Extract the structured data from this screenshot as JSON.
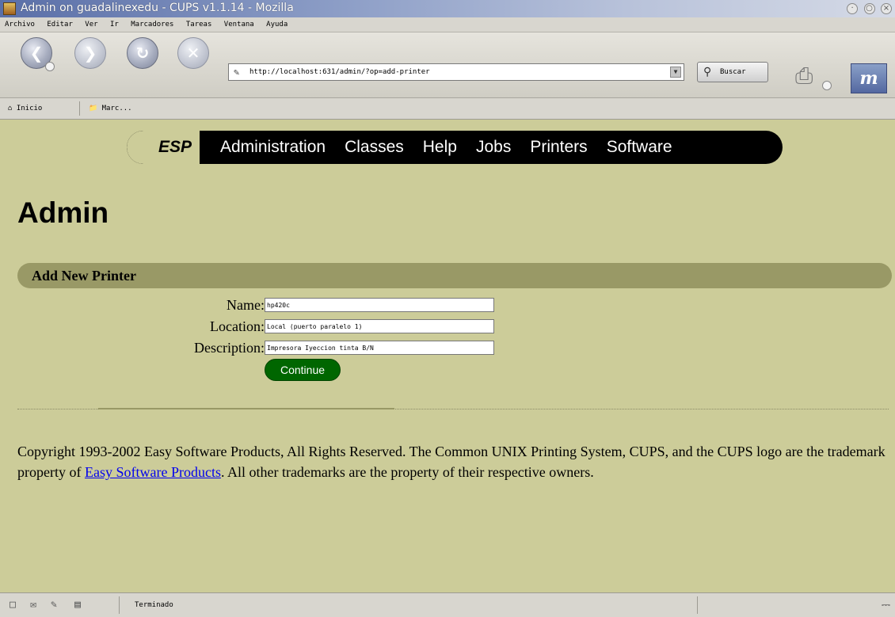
{
  "window": {
    "title": "Admin on guadalinexedu - CUPS v1.1.14 - Mozilla"
  },
  "menu": [
    "Archivo",
    "Editar",
    "Ver",
    "Ir",
    "Marcadores",
    "Tareas",
    "Ventana",
    "Ayuda"
  ],
  "toolbar": {
    "url": "http://localhost:631/admin/?op=add-printer",
    "search_label": "Buscar"
  },
  "bookmarks": {
    "home_label": "Inicio",
    "marc_label": "Marc..."
  },
  "page": {
    "nav": {
      "brand": "ESP",
      "links": [
        "Administration",
        "Classes",
        "Help",
        "Jobs",
        "Printers",
        "Software"
      ]
    },
    "heading": "Admin",
    "section_title": "Add New Printer",
    "form": {
      "name_label": "Name:",
      "name_value": "hp420c",
      "location_label": "Location:",
      "location_value": "Local (puerto paralelo 1)",
      "description_label": "Description:",
      "description_value": "Impresora Iyeccion tinta B/N",
      "continue_label": "Continue"
    },
    "copyright": {
      "before": "Copyright 1993-2002 Easy Software Products, All Rights Reserved. The Common UNIX Printing System, CUPS, and the CUPS logo are the trademark property of ",
      "link": "Easy Software Products",
      "after": ". All other trademarks are the property of their respective owners."
    }
  },
  "statusbar": {
    "text": "Terminado"
  },
  "colors": {
    "page_bg": "#cccc99",
    "section_bar": "#999966",
    "continue_bg": "#006600",
    "nav_bg": "#000000"
  }
}
